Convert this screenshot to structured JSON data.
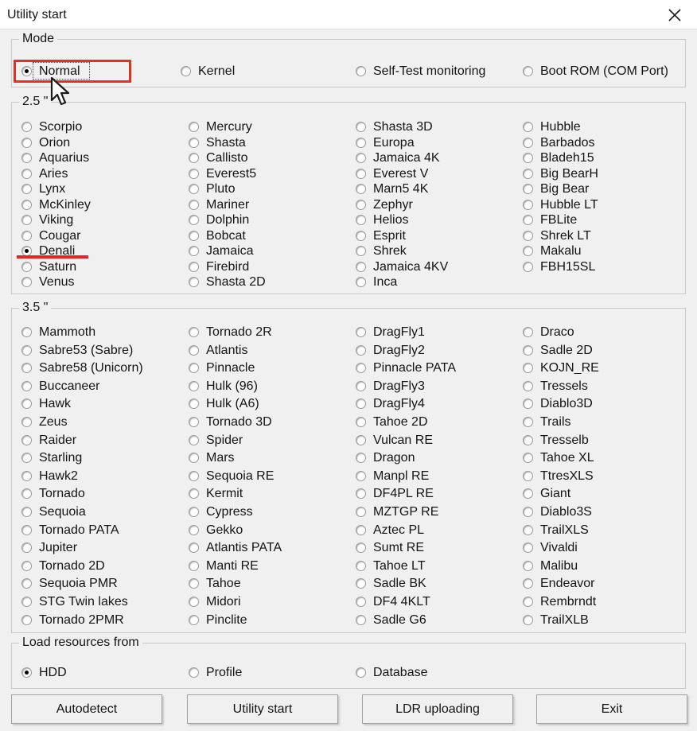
{
  "window": {
    "title": "Utility start",
    "close_icon": "close-icon"
  },
  "mode": {
    "legend": "Mode",
    "options": [
      {
        "label": "Normal",
        "checked": true
      },
      {
        "label": "Kernel",
        "checked": false
      },
      {
        "label": "Self-Test monitoring",
        "checked": false
      },
      {
        "label": "Boot ROM (COM Port)",
        "checked": false
      }
    ]
  },
  "drives_25": {
    "legend": "2.5 \"",
    "columns": [
      [
        {
          "label": "Scorpio",
          "checked": false
        },
        {
          "label": "Orion",
          "checked": false
        },
        {
          "label": "Aquarius",
          "checked": false
        },
        {
          "label": "Aries",
          "checked": false
        },
        {
          "label": "Lynx",
          "checked": false
        },
        {
          "label": "McKinley",
          "checked": false
        },
        {
          "label": "Viking",
          "checked": false
        },
        {
          "label": "Cougar",
          "checked": false
        },
        {
          "label": "Denali",
          "checked": true
        },
        {
          "label": "Saturn",
          "checked": false
        },
        {
          "label": "Venus",
          "checked": false
        }
      ],
      [
        {
          "label": "Mercury",
          "checked": false
        },
        {
          "label": "Shasta",
          "checked": false
        },
        {
          "label": "Callisto",
          "checked": false
        },
        {
          "label": "Everest5",
          "checked": false
        },
        {
          "label": "Pluto",
          "checked": false
        },
        {
          "label": "Mariner",
          "checked": false
        },
        {
          "label": "Dolphin",
          "checked": false
        },
        {
          "label": "Bobcat",
          "checked": false
        },
        {
          "label": "Jamaica",
          "checked": false
        },
        {
          "label": "Firebird",
          "checked": false
        },
        {
          "label": "Shasta 2D",
          "checked": false
        }
      ],
      [
        {
          "label": "Shasta 3D",
          "checked": false
        },
        {
          "label": "Europa",
          "checked": false
        },
        {
          "label": "Jamaica 4K",
          "checked": false
        },
        {
          "label": "Everest V",
          "checked": false
        },
        {
          "label": "Marn5 4K",
          "checked": false
        },
        {
          "label": "Zephyr",
          "checked": false
        },
        {
          "label": "Helios",
          "checked": false
        },
        {
          "label": "Esprit",
          "checked": false
        },
        {
          "label": "Shrek",
          "checked": false
        },
        {
          "label": "Jamaica 4KV",
          "checked": false
        },
        {
          "label": "Inca",
          "checked": false
        }
      ],
      [
        {
          "label": "Hubble",
          "checked": false
        },
        {
          "label": "Barbados",
          "checked": false
        },
        {
          "label": "Bladeh15",
          "checked": false
        },
        {
          "label": "Big BearH",
          "checked": false
        },
        {
          "label": "Big Bear",
          "checked": false
        },
        {
          "label": "Hubble LT",
          "checked": false
        },
        {
          "label": "FBLite",
          "checked": false
        },
        {
          "label": "Shrek LT",
          "checked": false
        },
        {
          "label": "Makalu",
          "checked": false
        },
        {
          "label": "FBH15SL",
          "checked": false
        }
      ]
    ]
  },
  "drives_35": {
    "legend": "3.5 \"",
    "columns": [
      [
        {
          "label": "Mammoth",
          "checked": false
        },
        {
          "label": "Sabre53 (Sabre)",
          "checked": false
        },
        {
          "label": "Sabre58 (Unicorn)",
          "checked": false
        },
        {
          "label": "Buccaneer",
          "checked": false
        },
        {
          "label": "Hawk",
          "checked": false
        },
        {
          "label": "Zeus",
          "checked": false
        },
        {
          "label": "Raider",
          "checked": false
        },
        {
          "label": "Starling",
          "checked": false
        },
        {
          "label": "Hawk2",
          "checked": false
        },
        {
          "label": "Tornado",
          "checked": false
        },
        {
          "label": "Sequoia",
          "checked": false
        },
        {
          "label": "Tornado PATA",
          "checked": false
        },
        {
          "label": "Jupiter",
          "checked": false
        },
        {
          "label": "Tornado 2D",
          "checked": false
        },
        {
          "label": "Sequoia PMR",
          "checked": false
        },
        {
          "label": "STG Twin lakes",
          "checked": false
        },
        {
          "label": "Tornado 2PMR",
          "checked": false
        }
      ],
      [
        {
          "label": "Tornado 2R",
          "checked": false
        },
        {
          "label": "Atlantis",
          "checked": false
        },
        {
          "label": "Pinnacle",
          "checked": false
        },
        {
          "label": "Hulk (96)",
          "checked": false
        },
        {
          "label": "Hulk (A6)",
          "checked": false
        },
        {
          "label": "Tornado 3D",
          "checked": false
        },
        {
          "label": "Spider",
          "checked": false
        },
        {
          "label": "Mars",
          "checked": false
        },
        {
          "label": "Sequoia RE",
          "checked": false
        },
        {
          "label": "Kermit",
          "checked": false
        },
        {
          "label": "Cypress",
          "checked": false
        },
        {
          "label": "Gekko",
          "checked": false
        },
        {
          "label": "Atlantis PATA",
          "checked": false
        },
        {
          "label": "Manti RE",
          "checked": false
        },
        {
          "label": "Tahoe",
          "checked": false
        },
        {
          "label": "Midori",
          "checked": false
        },
        {
          "label": "Pinclite",
          "checked": false
        }
      ],
      [
        {
          "label": "DragFly1",
          "checked": false
        },
        {
          "label": "DragFly2",
          "checked": false
        },
        {
          "label": "Pinnacle PATA",
          "checked": false
        },
        {
          "label": "DragFly3",
          "checked": false
        },
        {
          "label": "DragFly4",
          "checked": false
        },
        {
          "label": "Tahoe 2D",
          "checked": false
        },
        {
          "label": "Vulcan RE",
          "checked": false
        },
        {
          "label": "Dragon",
          "checked": false
        },
        {
          "label": "Manpl RE",
          "checked": false
        },
        {
          "label": "DF4PL RE",
          "checked": false
        },
        {
          "label": "MZTGP RE",
          "checked": false
        },
        {
          "label": "Aztec PL",
          "checked": false
        },
        {
          "label": "Sumt RE",
          "checked": false
        },
        {
          "label": "Tahoe LT",
          "checked": false
        },
        {
          "label": "Sadle BK",
          "checked": false
        },
        {
          "label": "DF4 4KLT",
          "checked": false
        },
        {
          "label": "Sadle G6",
          "checked": false
        }
      ],
      [
        {
          "label": "Draco",
          "checked": false
        },
        {
          "label": "Sadle 2D",
          "checked": false
        },
        {
          "label": "KOJN_RE",
          "checked": false
        },
        {
          "label": "Tressels",
          "checked": false
        },
        {
          "label": "Diablo3D",
          "checked": false
        },
        {
          "label": "Trails",
          "checked": false
        },
        {
          "label": "Tresselb",
          "checked": false
        },
        {
          "label": "Tahoe XL",
          "checked": false
        },
        {
          "label": "TtresXLS",
          "checked": false
        },
        {
          "label": "Giant",
          "checked": false
        },
        {
          "label": "Diablo3S",
          "checked": false
        },
        {
          "label": "TrailXLS",
          "checked": false
        },
        {
          "label": "Vivaldi",
          "checked": false
        },
        {
          "label": "Malibu",
          "checked": false
        },
        {
          "label": "Endeavor",
          "checked": false
        },
        {
          "label": "Rembrndt",
          "checked": false
        },
        {
          "label": "TrailXLB",
          "checked": false
        }
      ]
    ]
  },
  "load_resources": {
    "legend": "Load resources from",
    "options": [
      {
        "label": "HDD",
        "checked": true
      },
      {
        "label": "Profile",
        "checked": false
      },
      {
        "label": "Database",
        "checked": false
      }
    ]
  },
  "buttons": [
    {
      "label": "Autodetect"
    },
    {
      "label": "Utility start"
    },
    {
      "label": "LDR uploading"
    },
    {
      "label": "Exit"
    }
  ],
  "annotations": {
    "highlight_color": "#e03127",
    "underline_color": "#e8251c",
    "highlighted_option": "Normal",
    "underlined_option": "Denali"
  }
}
